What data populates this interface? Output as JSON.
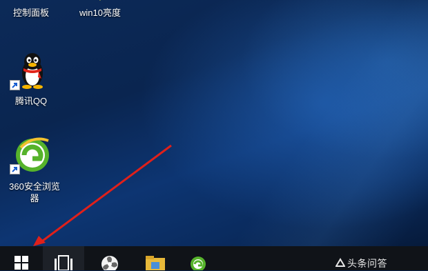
{
  "desktop": {
    "icons": [
      {
        "label": "控制面板"
      },
      {
        "label": "win10亮度"
      },
      {
        "label": "腾讯QQ"
      },
      {
        "label_line1": "360安全浏览",
        "label_line2": "器"
      }
    ]
  },
  "taskbar": {
    "buttons": [
      "windows-start-icon",
      "task-view-icon",
      "fan-app-icon",
      "file-explorer-icon",
      "browser-360-icon"
    ],
    "tray_text": "头条问答"
  },
  "annotation": {
    "arrow_color": "#e0201a"
  },
  "colors": {
    "taskbar": "#101318",
    "wallpaper_dark": "#0a2550",
    "wallpaper_light": "#2a6ec0"
  }
}
